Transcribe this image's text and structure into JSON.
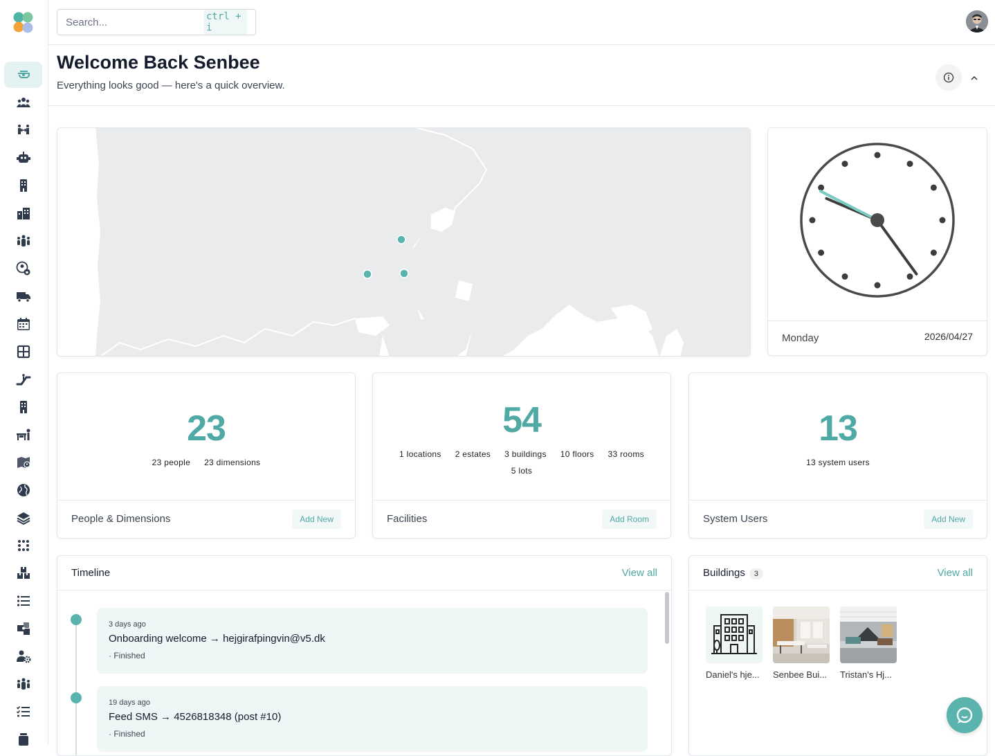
{
  "colors": {
    "accent": "#4fa9a4",
    "accent_light": "#e4f3f2",
    "map_land": "#e9ebed",
    "map_water": "#ffffff"
  },
  "search": {
    "placeholder": "Search...",
    "shortcut": "ctrl + i"
  },
  "sidebar": {
    "items": [
      {
        "icon": "dashboard-icon",
        "active": true
      },
      {
        "icon": "people-icon"
      },
      {
        "icon": "people-arrows-icon"
      },
      {
        "icon": "robot-icon"
      },
      {
        "icon": "building-icon"
      },
      {
        "icon": "city-icon"
      },
      {
        "icon": "person-group-icon"
      },
      {
        "icon": "user-lock-icon"
      },
      {
        "icon": "truck-icon"
      },
      {
        "icon": "calendar-icon"
      },
      {
        "icon": "floor-plan-icon"
      },
      {
        "icon": "escalator-icon"
      },
      {
        "icon": "building-alt-icon"
      },
      {
        "icon": "desk-icon"
      },
      {
        "icon": "map-marker-icon"
      },
      {
        "icon": "globe-icon"
      },
      {
        "icon": "layers-icon"
      },
      {
        "icon": "grid-dots-icon"
      },
      {
        "icon": "boxes-icon"
      },
      {
        "icon": "list-icon"
      },
      {
        "icon": "puzzle-icon"
      },
      {
        "icon": "user-gear-icon"
      },
      {
        "icon": "people-icon-2"
      },
      {
        "icon": "checklist-icon"
      },
      {
        "icon": "more-icon"
      }
    ]
  },
  "header": {
    "title": "Welcome Back Senbee",
    "subtitle": "Everything looks good — here's a quick overview."
  },
  "clock": {
    "day": "Monday",
    "date": "2026/04/27",
    "hour": 9,
    "minute": 46
  },
  "stats": [
    {
      "value": "23",
      "subs": [
        "23 people",
        "23 dimensions"
      ],
      "title": "People & Dimensions",
      "button": "Add New"
    },
    {
      "value": "54",
      "subs": [
        "1 locations",
        "2 estates",
        "3 buildings",
        "10 floors",
        "33 rooms",
        "5 lots"
      ],
      "title": "Facilities",
      "button": "Add Room"
    },
    {
      "value": "13",
      "subs": [
        "13 system users"
      ],
      "title": "System Users",
      "button": "Add New"
    }
  ],
  "timeline": {
    "title": "Timeline",
    "view_all": "View all",
    "items": [
      {
        "ago": "3 days ago",
        "title": "Onboarding welcome → hejgirafpingvin@v5.dk",
        "status": "· Finished"
      },
      {
        "ago": "19 days ago",
        "title": "Feed SMS → 4526818348 (post #10)",
        "status": "· Finished"
      }
    ]
  },
  "buildings": {
    "title": "Buildings",
    "count": "3",
    "view_all": "View all",
    "items": [
      {
        "name": "Daniel's hje..."
      },
      {
        "name": "Senbee Bui..."
      },
      {
        "name": "Tristan's Hj..."
      }
    ]
  }
}
